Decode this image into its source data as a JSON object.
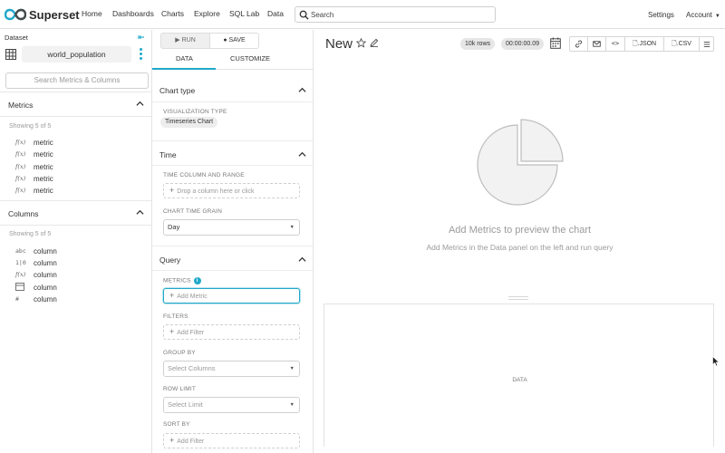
{
  "app": {
    "brand": "Superset",
    "nav": [
      "Home",
      "Dashboards",
      "Charts",
      "Explore",
      "SQL Lab",
      "Data"
    ],
    "search_placeholder": "Search",
    "settings": "Settings",
    "account": "Account"
  },
  "dataset": {
    "label": "Dataset",
    "name": "world_population",
    "search_placeholder": "Search Metrics & Columns",
    "metrics_title": "Metrics",
    "metrics_showing": "Showing 5 of 5",
    "metrics": [
      {
        "icon": "f(x)",
        "label": "metric"
      },
      {
        "icon": "f(x)",
        "label": "metric"
      },
      {
        "icon": "f(x)",
        "label": "metric"
      },
      {
        "icon": "f(x)",
        "label": "metric"
      },
      {
        "icon": "f(x)",
        "label": "metric"
      }
    ],
    "columns_title": "Columns",
    "columns_showing": "Showing 5 of 5",
    "columns": [
      {
        "icon": "abc",
        "label": "column"
      },
      {
        "icon": "1|0",
        "label": "column"
      },
      {
        "icon": "f(x)",
        "label": "column"
      },
      {
        "icon": "calendar-icon",
        "label": "column"
      },
      {
        "icon": "#",
        "label": "column"
      }
    ]
  },
  "controls": {
    "run": "RUN",
    "save": "SAVE",
    "tab_data": "DATA",
    "tab_customize": "CUSTOMIZE",
    "chart_type_title": "Chart type",
    "viz_type_label": "VISUALIZATION TYPE",
    "viz_type_value": "Timeseries Chart",
    "time_title": "Time",
    "time_col_label": "TIME COLUMN AND RANGE",
    "time_col_placeholder": "Drop a column here or click",
    "grain_label": "CHART TIME GRAIN",
    "grain_value": "Day",
    "query_title": "Query",
    "metrics_label": "METRICS",
    "metrics_placeholder": "Add Metric",
    "filters_label": "FILTERS",
    "filters_placeholder": "Add Filter",
    "groupby_label": "GROUP BY",
    "groupby_placeholder": "Select Columns",
    "rowlimit_label": "ROW LIMIT",
    "rowlimit_placeholder": "Select Limit",
    "sortby_label": "SORT BY",
    "sortby_placeholder": "Add Filter"
  },
  "chart": {
    "title": "New",
    "row_count": "10k rows",
    "duration": "00:00:00.09",
    "json": ".JSON",
    "csv": ".CSV",
    "empty_title": "Add Metrics to preview the chart",
    "empty_subtitle": "Add Metrics in the Data panel on the left and run query",
    "data_pane_label": "DATA"
  },
  "colors": {
    "accent": "#1fa8c9",
    "muted_text": "#9b9b9b"
  }
}
